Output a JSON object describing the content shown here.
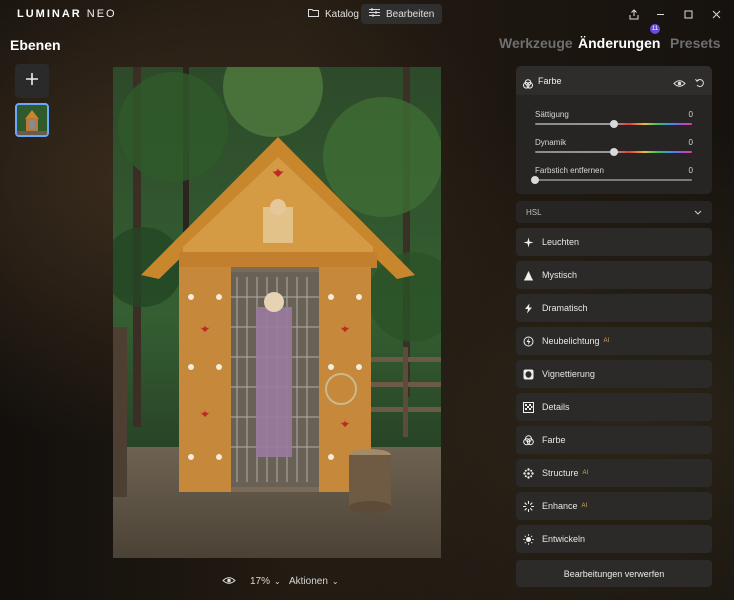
{
  "app": {
    "logo_main": "LUMINAR",
    "logo_sub": "NEO"
  },
  "topbar": {
    "katalog": "Katalog",
    "bearbeiten": "Bearbeiten"
  },
  "left": {
    "title": "Ebenen"
  },
  "tabs": {
    "werkzeuge": "Werkzeuge",
    "aenderungen": "Änderungen",
    "presets": "Presets",
    "badge": "11"
  },
  "farbe_panel": {
    "title": "Farbe",
    "sliders": [
      {
        "label": "Sättigung",
        "value": "0",
        "level": 0.5
      },
      {
        "label": "Dynamik",
        "value": "0",
        "level": 0.5
      },
      {
        "label": "Farbstich entfernen",
        "value": "0",
        "level": 0.0
      }
    ],
    "hsl": "HSL"
  },
  "tools": [
    {
      "label": "Leuchten",
      "icon": "sparkle-icon",
      "ai": ""
    },
    {
      "label": "Mystisch",
      "icon": "mystic-icon",
      "ai": ""
    },
    {
      "label": "Dramatisch",
      "icon": "lightning-icon",
      "ai": ""
    },
    {
      "label": "Neubelichtung",
      "icon": "relight-icon",
      "ai": "AI"
    },
    {
      "label": "Vignettierung",
      "icon": "vignette-icon",
      "ai": ""
    },
    {
      "label": "Details",
      "icon": "details-icon",
      "ai": ""
    },
    {
      "label": "Farbe",
      "icon": "color-icon",
      "ai": ""
    },
    {
      "label": "Structure",
      "icon": "structure-icon",
      "ai": "AI"
    },
    {
      "label": "Enhance",
      "icon": "enhance-icon",
      "ai": "AI"
    },
    {
      "label": "Entwickeln",
      "icon": "sun-icon",
      "ai": ""
    }
  ],
  "bottom": {
    "zoom": "17%",
    "actions": "Aktionen"
  },
  "discard": "Bearbeitungen verwerfen",
  "colors": {
    "accent": "#6c4bd8",
    "selection": "#6aa8ff"
  }
}
